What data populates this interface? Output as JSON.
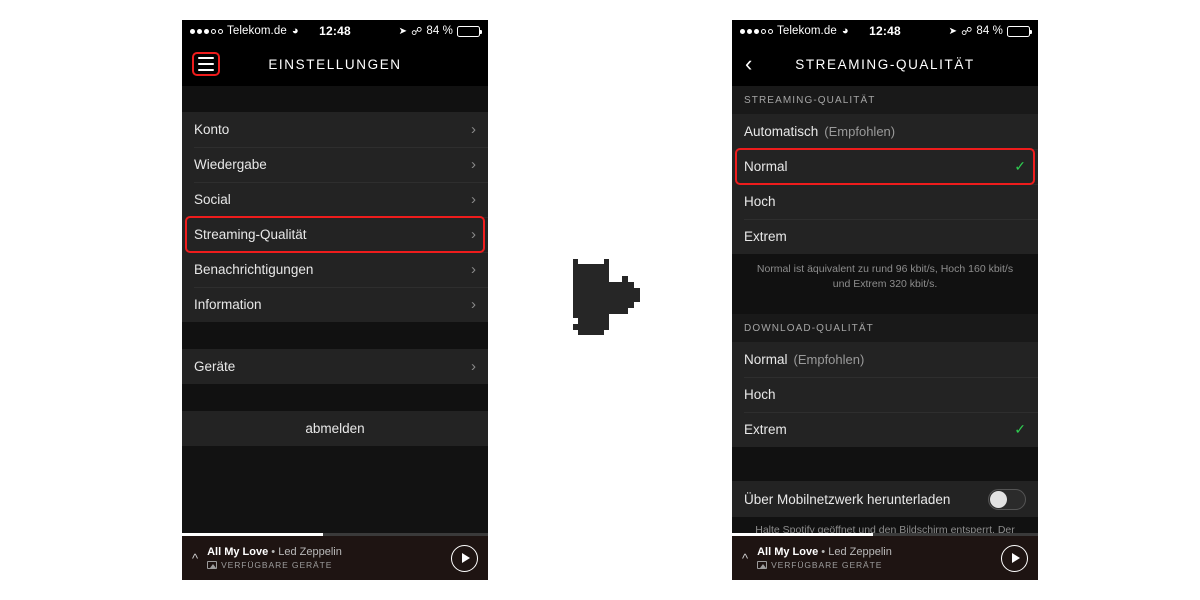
{
  "status_bar": {
    "carrier": "Telekom.de",
    "time": "12:48",
    "battery_text": "84 %",
    "battery_percent": 84,
    "wifi_icon": "wifi-icon",
    "location_icon": "location-arrow-icon",
    "bluetooth_icon": "bluetooth-icon"
  },
  "left_phone": {
    "nav": {
      "title": "EINSTELLUNGEN",
      "menu_icon": "hamburger-menu-icon"
    },
    "items": [
      {
        "label": "Konto",
        "accessory": "chevron-right-icon"
      },
      {
        "label": "Wiedergabe",
        "accessory": "chevron-right-icon"
      },
      {
        "label": "Social",
        "accessory": "chevron-right-icon"
      },
      {
        "label": "Streaming-Qualität",
        "accessory": "chevron-right-icon",
        "highlighted": true
      },
      {
        "label": "Benachrichtigungen",
        "accessory": "chevron-right-icon"
      },
      {
        "label": "Information",
        "accessory": "chevron-right-icon"
      }
    ],
    "devices_item": {
      "label": "Geräte",
      "accessory": "chevron-right-icon"
    },
    "logout_item": {
      "label": "abmelden"
    }
  },
  "right_phone": {
    "nav": {
      "title": "STREAMING-QUALITÄT",
      "back_icon": "chevron-left-icon"
    },
    "streaming_section": {
      "header": "STREAMING-QUALITÄT",
      "options": [
        {
          "label": "Automatisch",
          "note": "(Empfohlen)",
          "selected": false
        },
        {
          "label": "Normal",
          "note": "",
          "selected": true,
          "highlighted": true
        },
        {
          "label": "Hoch",
          "note": "",
          "selected": false
        },
        {
          "label": "Extrem",
          "note": "",
          "selected": false
        }
      ],
      "footer": "Normal ist äquivalent zu rund 96 kbit/s, Hoch 160 kbit/s und Extrem 320 kbit/s."
    },
    "download_section": {
      "header": "DOWNLOAD-QUALITÄT",
      "options": [
        {
          "label": "Normal",
          "note": "(Empfohlen)",
          "selected": false
        },
        {
          "label": "Hoch",
          "note": "",
          "selected": false
        },
        {
          "label": "Extrem",
          "note": "",
          "selected": true
        }
      ]
    },
    "cellular_row": {
      "label": "Über Mobilnetzwerk herunterladen",
      "toggle_state": "off"
    },
    "cellular_footer": "Halte Spotify geöffnet und den Bildschirm entsperrt. Der"
  },
  "now_playing": {
    "track": "All My Love",
    "separator": "•",
    "artist": "Led Zeppelin",
    "devices_label": "VERFÜGBARE GERÄTE",
    "devices_icon": "available-devices-icon",
    "expand_icon": "chevron-up-icon",
    "play_icon": "play-button-icon",
    "progress_percent": 46
  },
  "colors": {
    "accent_red": "#ee1c1c",
    "check_green": "#2ecc50",
    "row_bg": "#232323",
    "gap_bg": "#111111",
    "player_bg": "#1e1412"
  },
  "annotation_shape": {
    "name": "cursor-blob-shape",
    "color": "#262626"
  }
}
